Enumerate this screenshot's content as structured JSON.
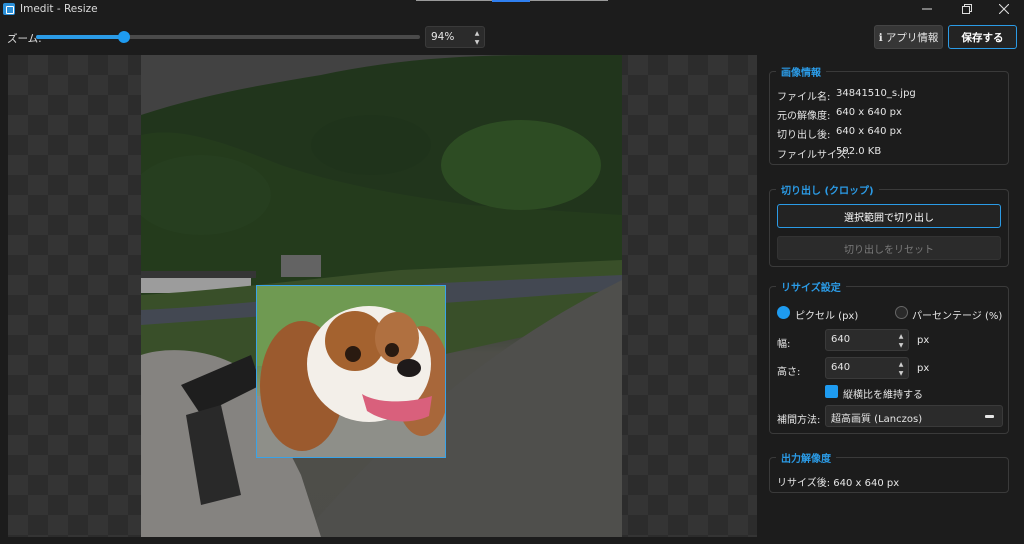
{
  "window": {
    "title": "Imedit - Resize"
  },
  "toolbar": {
    "zoom_label": "ズーム:",
    "zoom_value": "94%",
    "zoom_fraction": 0.23,
    "info_button": "ℹ アプリ情報",
    "save_button": "保存する"
  },
  "image_info": {
    "heading": "画像情報",
    "rows": [
      {
        "label": "ファイル名:",
        "value": "34841510_s.jpg"
      },
      {
        "label": "元の解像度:",
        "value": "640 x 640 px"
      },
      {
        "label": "切り出し後:",
        "value": "640 x 640 px"
      },
      {
        "label": "ファイルサイズ:",
        "value": "592.0 KB"
      }
    ]
  },
  "crop": {
    "heading": "切り出し (クロップ)",
    "crop_button": "選択範囲で切り出し",
    "reset_button": "切り出しをリセット"
  },
  "resize": {
    "heading": "リサイズ設定",
    "unit_pixel": "ピクセル (px)",
    "unit_percent": "パーセンテージ (%)",
    "width_label": "幅:",
    "width_value": "640",
    "width_unit": "px",
    "height_label": "高さ:",
    "height_value": "640",
    "height_unit": "px",
    "keep_ratio": "縦横比を維持する",
    "interp_label": "補間方法:",
    "interp_value": "超高画質 (Lanczos)"
  },
  "output": {
    "heading": "出力解像度",
    "text": "リサイズ後: 640 x 640 px"
  },
  "colors": {
    "accent": "#2b9be6",
    "background": "#1c1c1c",
    "panel_border": "#3a3a3a"
  }
}
